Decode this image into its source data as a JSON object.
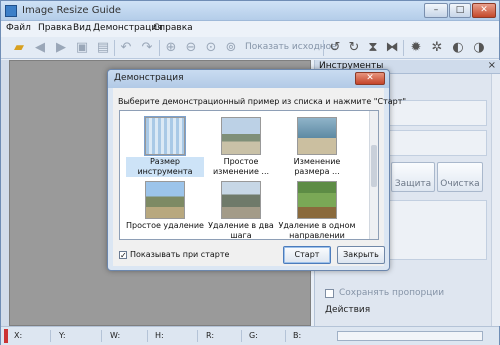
{
  "window": {
    "title": "Image Resize Guide",
    "controls": {
      "minimize": "–",
      "maximize": "□",
      "close": "✕"
    }
  },
  "menu": [
    "Файл",
    "Правка",
    "Вид",
    "Демонстрация",
    "Справка"
  ],
  "toolbar": {
    "show_original_label": "Показать исходное"
  },
  "panel": {
    "title": "Инструменты",
    "close": "×",
    "buttons": {
      "protect": "Защита",
      "clear": "Очистка"
    },
    "keep_proportions": "Сохранять пропорции",
    "actions": "Действия"
  },
  "statusbar": {
    "x": "X:",
    "y": "Y:",
    "w": "W:",
    "h": "H:",
    "r": "R:",
    "g": "G:",
    "b": "B:"
  },
  "dialog": {
    "title": "Демонстрация",
    "close": "✕",
    "prompt": "Выберите демонстрационный пример из списка и нажмите \"Старт\"",
    "items": [
      {
        "label": "Размер инструмента",
        "selected": true
      },
      {
        "label": "Простое изменение ...",
        "selected": false
      },
      {
        "label": "Изменение размера ...",
        "selected": false
      },
      {
        "label": "Простое удаление",
        "selected": false
      },
      {
        "label": "Удаление в два шага",
        "selected": false
      },
      {
        "label": "Удаление в одном направлении",
        "selected": false
      }
    ],
    "show_on_start": {
      "label": "Показывать при старте",
      "checked": true,
      "mark": "✓"
    },
    "start_button": "Старт",
    "close_button": "Закрыть"
  }
}
